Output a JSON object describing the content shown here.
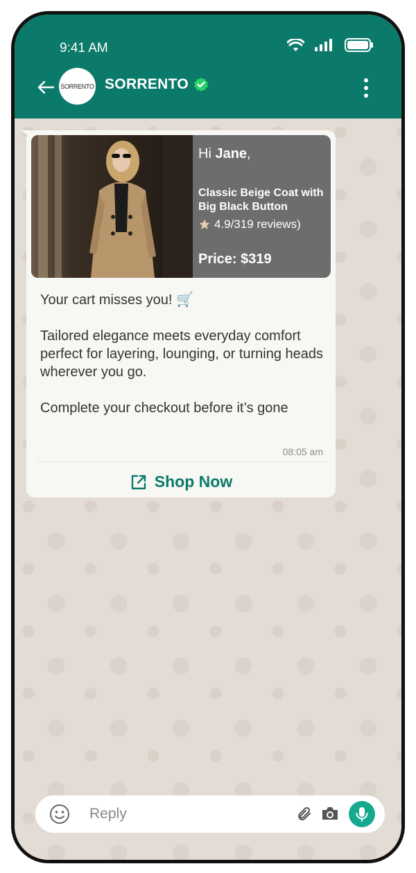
{
  "status_bar": {
    "time": "9:41 AM"
  },
  "chat_header": {
    "avatar_text": "SORRENTO",
    "contact_name": "SORRENTO"
  },
  "product_card": {
    "greeting_prefix": "Hi ",
    "customer_name": "Jane",
    "greeting_suffix": ",",
    "product_name": "Classic Beige Coat with Big Black Button",
    "rating_text": "4.9/319 reviews)",
    "price": "Price: $319"
  },
  "message": {
    "line1": "Your cart misses you! 🛒",
    "line2": "Tailored elegance meets everyday comfort perfect for layering, lounging, or turning heads wherever you go.",
    "line3": "Complete your checkout before it’s gone",
    "timestamp": "08:05 am"
  },
  "cta": {
    "label": "Shop Now"
  },
  "input_bar": {
    "placeholder": "Reply"
  },
  "colors": {
    "header": "#0b7a6a",
    "accent": "#17a98f",
    "card_bg": "#6d6d6d",
    "chat_bg": "#e3dcd4"
  },
  "icons": [
    "back-arrow-icon",
    "verified-badge-icon",
    "more-menu-icon",
    "external-link-icon",
    "emoji-icon",
    "paperclip-icon",
    "camera-icon",
    "mic-icon",
    "star-icon",
    "wifi-icon",
    "signal-icon",
    "battery-icon"
  ]
}
